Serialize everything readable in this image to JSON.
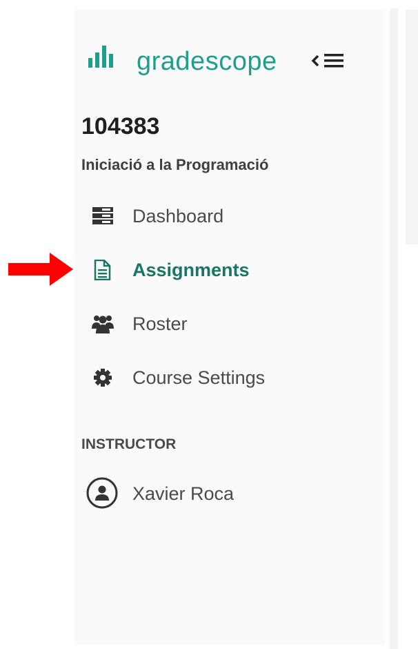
{
  "brand": {
    "name": "gradescope",
    "accent_color": "#1f9e8b",
    "logo_icon": "gradescope-bars-logo"
  },
  "header": {
    "collapse_icon": "collapse-menu-icon"
  },
  "course": {
    "id": "104383",
    "name": "Iniciació a la Programació"
  },
  "nav": {
    "items": [
      {
        "label": "Dashboard",
        "icon": "dashboard-icon",
        "active": false
      },
      {
        "label": "Assignments",
        "icon": "document-icon",
        "active": true
      },
      {
        "label": "Roster",
        "icon": "users-icon",
        "active": false
      },
      {
        "label": "Course Settings",
        "icon": "gear-icon",
        "active": false
      }
    ],
    "active_color": "#1a7564"
  },
  "instructor_section": {
    "heading": "INSTRUCTOR",
    "name": "Xavier Roca",
    "icon": "user-avatar-icon"
  },
  "annotation": {
    "arrow_color": "#ff0000",
    "points_to": "Assignments"
  }
}
